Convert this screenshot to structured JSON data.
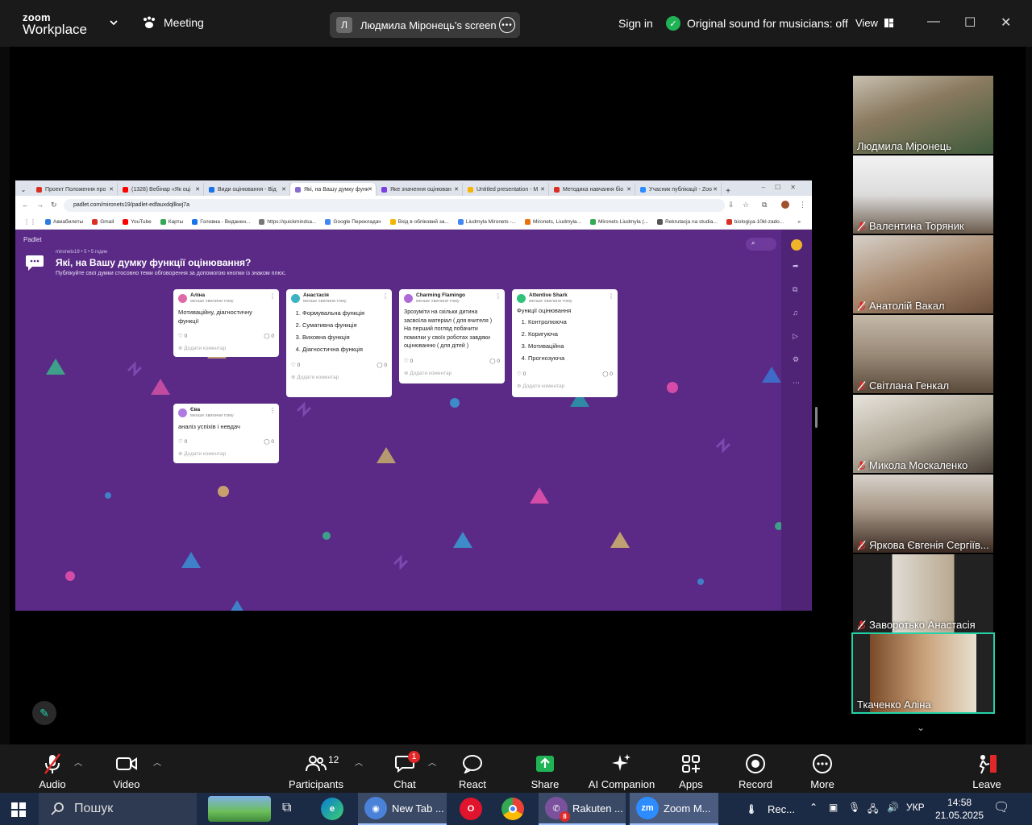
{
  "zoom": {
    "logo_small": "zoom",
    "logo_big": "Workplace",
    "meeting_label": "Meeting",
    "screen_share_initial": "Л",
    "screen_share_label": "Людмила Міронець's screen",
    "sign_in": "Sign in",
    "original_sound": "Original sound for musicians: off",
    "view": "View"
  },
  "chrome": {
    "tabs": [
      {
        "label": "Проект Положення про",
        "color": "#d93025"
      },
      {
        "label": "(1328) Вебінар «Як оці",
        "color": "#ff0000"
      },
      {
        "label": "Види оцінювання - Від",
        "color": "#1a73e8"
      },
      {
        "label": "Які, на Вашу думку функ",
        "color": "#8a6bd1",
        "active": true
      },
      {
        "label": "Яке значення оцінюван",
        "color": "#7b3fe4"
      },
      {
        "label": "Untitled presentation - M",
        "color": "#f4b400"
      },
      {
        "label": "Методика навчання біо",
        "color": "#d93025"
      },
      {
        "label": "Учасник публікації - Zoo",
        "color": "#2d8cff"
      }
    ],
    "url": "padlet.com/mironets19/padlet-edfauxdqllkwj7a",
    "bookmarks": [
      {
        "label": "Авиабилеты",
        "color": "#2d7be0"
      },
      {
        "label": "Gmail",
        "color": "#d93025"
      },
      {
        "label": "YouTube",
        "color": "#ff0000"
      },
      {
        "label": "Карты",
        "color": "#34a853"
      },
      {
        "label": "Головна - Виданен...",
        "color": "#1a73e8"
      },
      {
        "label": "https://quickmindsa...",
        "color": "#777777"
      },
      {
        "label": "Google Перекладач",
        "color": "#4285f4"
      },
      {
        "label": "Вхід в обліковий за...",
        "color": "#f4b400"
      },
      {
        "label": "Liudmyla Mironets -...",
        "color": "#4285f4"
      },
      {
        "label": "Mironets, Liudmyla...",
        "color": "#e8710a"
      },
      {
        "label": "Mironets Liudmyla (...",
        "color": "#34a853"
      },
      {
        "label": "Rekrutacja na studia...",
        "color": "#555555"
      },
      {
        "label": "biologiya-10kl-zado...",
        "color": "#d93025"
      }
    ]
  },
  "padlet": {
    "brand": "Padlet",
    "meta": "mironets19 • 5 • 5 годин",
    "title": "Які, на Вашу думку функції оцінювання?",
    "subtitle": "Публікуйте свої думки стосовно теми обговорення за допомогою кнопки із знаком плюс.",
    "comment_placeholder": "Додати коментар",
    "time_ago": "менше хвилини тому",
    "cards": [
      {
        "author": "Аліна",
        "text": "Мотиваційну, діагностичну функції",
        "likes": "0",
        "comments": "0",
        "dot": "#e06aa8"
      },
      {
        "author": "Анастасія",
        "list": [
          "Формувальна функція",
          "Сумативна функція",
          "Виховна функція",
          "Діагностична функція"
        ],
        "likes": "0",
        "comments": "0",
        "dot": "#3bb3c3"
      },
      {
        "author": "Charming Flamingo",
        "text": "Зрозуміти на скільки дитина засвоїла матеріал ( для вчителя ) На перший погляд побачити помилки у своїх роботах завдяки оцінюванню ( для дітей )",
        "likes": "0",
        "comments": "0",
        "dot": "#b06ad8"
      },
      {
        "author": "Attentive Shark",
        "intro": "Функції оцінювання",
        "list": [
          "Контролююча",
          "Коригуюча",
          "Мотиваційна",
          "Прогнозуюча"
        ],
        "likes": "0",
        "comments": "0",
        "dot": "#2fc27a"
      },
      {
        "author": "Єва",
        "text": "аналіз успіхів і невдач",
        "likes": "0",
        "comments": "0",
        "dot": "#b07ae0"
      }
    ]
  },
  "participants": [
    {
      "name": "Людмила Міронець",
      "muted": false
    },
    {
      "name": "Валентина Торяник",
      "muted": true
    },
    {
      "name": "Анатолій Вакал",
      "muted": true
    },
    {
      "name": "Світлана Генкал",
      "muted": true
    },
    {
      "name": "Микола Москаленко",
      "muted": true
    },
    {
      "name": "Яркова Євгенія Сергіїв...",
      "muted": true
    },
    {
      "name": "Заворотько Анастасія",
      "muted": true
    },
    {
      "name": "Ткаченко Аліна",
      "muted": false,
      "active": true
    }
  ],
  "toolbar": {
    "audio": "Audio",
    "video": "Video",
    "participants": "Participants",
    "participants_count": "12",
    "chat": "Chat",
    "chat_badge": "1",
    "react": "React",
    "share": "Share",
    "ai_companion": "AI Companion",
    "apps": "Apps",
    "record": "Record",
    "more": "More",
    "leave": "Leave"
  },
  "taskbar": {
    "search_placeholder": "Пошук",
    "apps": [
      {
        "label": "New Tab ..."
      },
      {
        "label": "Rakuten ...",
        "badge": "8"
      },
      {
        "label": "Zoom M..."
      },
      {
        "label": "Rec..."
      }
    ],
    "language": "УКР",
    "time": "14:58",
    "date": "21.05.2025"
  }
}
